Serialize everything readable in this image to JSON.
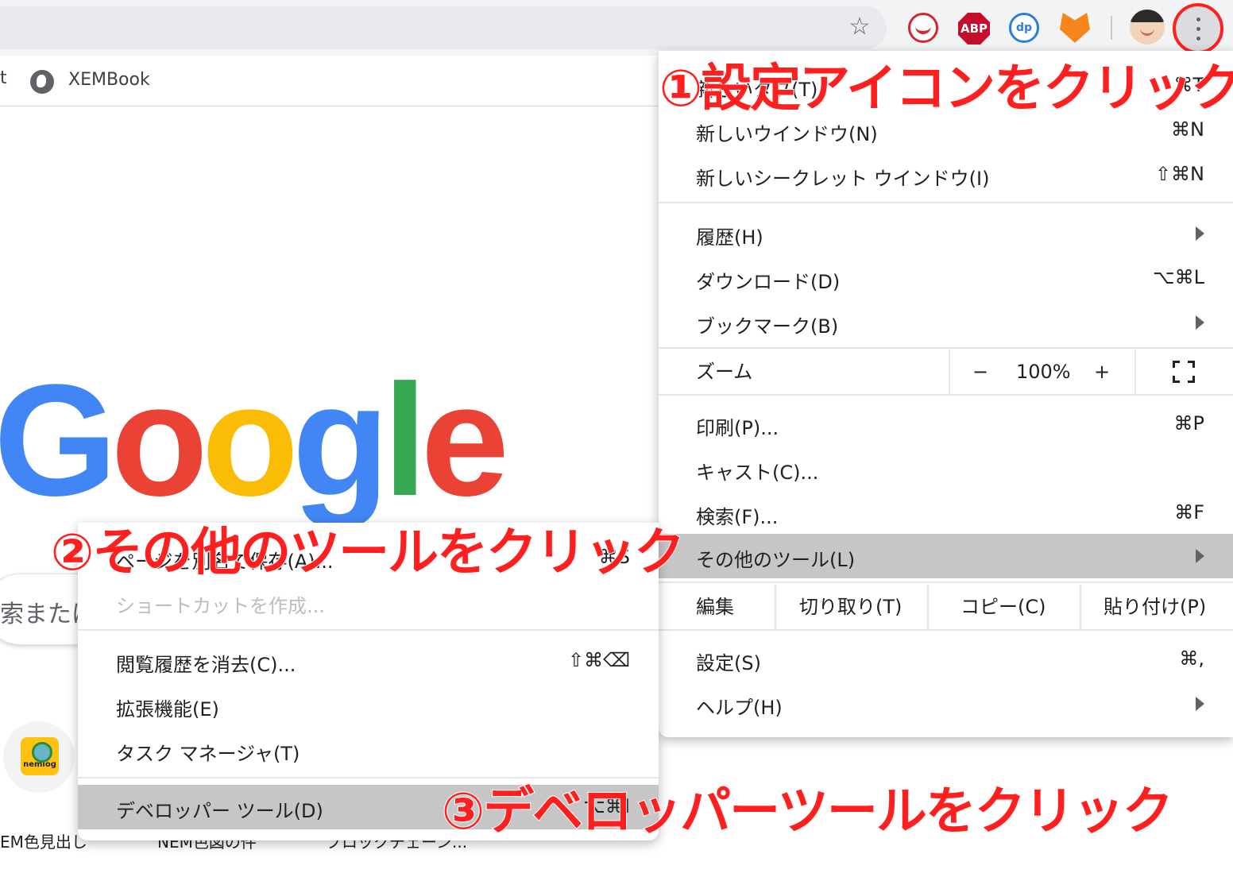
{
  "toolbar": {
    "star_icon": "star-icon",
    "extensions": [
      "trend-micro-icon",
      "adblock-plus-icon",
      "dp-extension-icon",
      "metamask-fox-icon"
    ],
    "abp_label": "ABP",
    "menu_icon": "kebab-menu-icon"
  },
  "bookmarks": {
    "cut_label": "t",
    "items": [
      {
        "label": "XEMBook",
        "icon": "globe-icon"
      }
    ]
  },
  "page": {
    "logo": {
      "letters": [
        "G",
        "o",
        "o",
        "g",
        "l",
        "e"
      ],
      "colors": [
        "#4285F4",
        "#EA4335",
        "#FBBC05",
        "#4285F4",
        "#34A853",
        "#EA4335"
      ]
    },
    "search_partial": "索または",
    "shortcut_tile_label": "nemlog",
    "shortcut_labels": [
      "EM色見出し",
      "NEM色図の件",
      "ブロックチェーン..."
    ]
  },
  "menu": {
    "items_top": [
      {
        "label": "新しいタブ(T)",
        "shortcut": "⌘T"
      },
      {
        "label": "新しいウインドウ(N)",
        "shortcut": "⌘N"
      },
      {
        "label": "新しいシークレット ウインドウ(I)",
        "shortcut": "⇧⌘N"
      }
    ],
    "items_mid": [
      {
        "label": "履歴(H)",
        "shortcut": ""
      },
      {
        "label": "ダウンロード(D)",
        "shortcut": "⌥⌘L"
      },
      {
        "label": "ブックマーク(B)",
        "shortcut": ""
      }
    ],
    "zoom": {
      "label": "ズーム",
      "minus": "−",
      "value": "100%",
      "plus": "+"
    },
    "items_tools": [
      {
        "label": "印刷(P)...",
        "shortcut": "⌘P"
      },
      {
        "label": "キャスト(C)...",
        "shortcut": ""
      },
      {
        "label": "検索(F)...",
        "shortcut": "⌘F"
      },
      {
        "label": "その他のツール(L)",
        "shortcut": ""
      }
    ],
    "edit": {
      "label": "編集",
      "cut": "切り取り(T)",
      "copy": "コピー(C)",
      "paste": "貼り付け(P)"
    },
    "items_bottom": [
      {
        "label": "設定(S)",
        "shortcut": "⌘,"
      },
      {
        "label": "ヘルプ(H)",
        "shortcut": ""
      }
    ]
  },
  "submenu": {
    "items_top": [
      {
        "label": "ページを別名で保存(A)...",
        "shortcut": "⌘S"
      },
      {
        "label": "ショートカットを作成...",
        "shortcut": ""
      }
    ],
    "items_mid": [
      {
        "label": "閲覧履歴を消去(C)...",
        "shortcut": "⇧⌘⌫"
      },
      {
        "label": "拡張機能(E)",
        "shortcut": ""
      },
      {
        "label": "タスク マネージャ(T)",
        "shortcut": ""
      }
    ],
    "items_bottom": [
      {
        "label": "デベロッパー ツール(D)",
        "shortcut": "⌥⌘I"
      }
    ]
  },
  "annotations": {
    "step1": "①設定アイコンをクリック",
    "step2": "②その他のツールをクリック",
    "step3": "③デベロッパーツールをクリック",
    "color": "#ff1f1f"
  }
}
